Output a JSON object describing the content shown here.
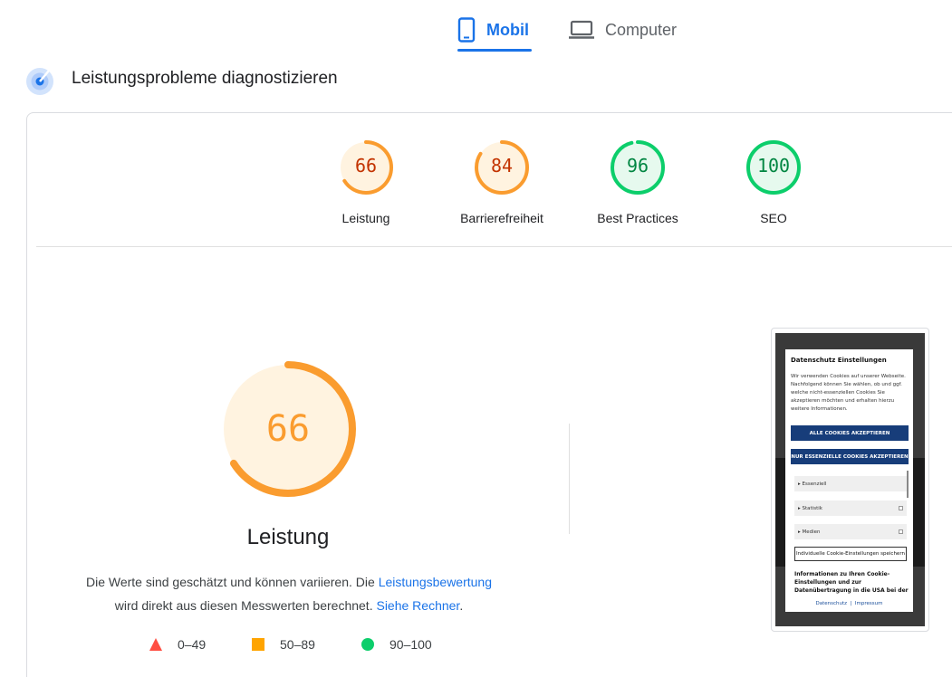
{
  "tabs": [
    {
      "label": "Mobil",
      "icon": "smartphone-icon",
      "active": true
    },
    {
      "label": "Computer",
      "icon": "laptop-icon",
      "active": false
    }
  ],
  "section": {
    "title": "Leistungsprobleme diagnostizieren",
    "icon": "diagnostics-icon"
  },
  "scores": [
    {
      "label": "Leistung",
      "value": "66",
      "color": "#fa9c2f",
      "text_color": "#c33300",
      "bg": "#fff3e0"
    },
    {
      "label": "Barrierefreiheit",
      "value": "84",
      "color": "#fa9c2f",
      "text_color": "#c33300",
      "bg": "#fff3e0"
    },
    {
      "label": "Best Practices",
      "value": "96",
      "color": "#0cce6b",
      "text_color": "#018642",
      "bg": "#e6f9ee"
    },
    {
      "label": "SEO",
      "value": "100",
      "color": "#0cce6b",
      "text_color": "#018642",
      "bg": "#e6f9ee"
    }
  ],
  "main_gauge": {
    "value": "66",
    "title": "Leistung",
    "color": "#fa9c2f",
    "bg": "#fff3e0"
  },
  "description": {
    "part1": "Die Werte sind geschätzt und können variieren. Die ",
    "link1": "Leistungsbewertung",
    "part2": "wird direkt aus diesen Messwerten berechnet. ",
    "link2": "Siehe Rechner",
    "part3": "."
  },
  "legend": [
    {
      "range": "0–49",
      "shape": "triangle",
      "color": "#ff4e42"
    },
    {
      "range": "50–89",
      "shape": "square",
      "color": "#ffa400"
    },
    {
      "range": "90–100",
      "shape": "circle",
      "color": "#0cce6b"
    }
  ],
  "screenshot": {
    "title": "Datenschutz Einstellungen",
    "text": "Wir verwenden Cookies auf unserer Webseite. Nachfolgend können Sie wählen, ob und ggf. welche nicht-essenziellen Cookies Sie akzeptieren möchten und erhalten hierzu weitere Informationen.",
    "btn_all": "ALLE COOKIES AKZEPTIEREN",
    "btn_essential": "NUR ESSENZIELLE COOKIES AKZEPTIEREN",
    "categories": [
      "Essenziell",
      "Statistik",
      "Medien"
    ],
    "save": "Individuelle Cookie-Einstellungen speichern",
    "info": "Informationen zu Ihren Cookie-Einstellungen und zur Datenübertragung in die USA bei der",
    "link_privacy": "Datenschutz",
    "link_sep": "|",
    "link_imprint": "Impressum"
  }
}
